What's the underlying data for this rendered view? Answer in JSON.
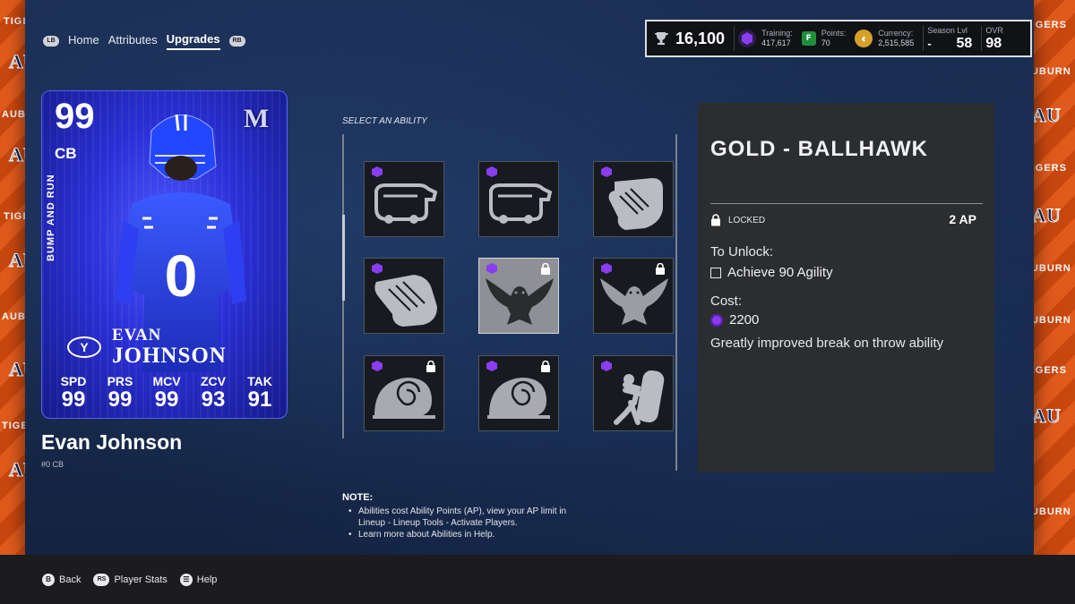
{
  "nav": {
    "lb": "LB",
    "rb": "RB",
    "tabs": [
      {
        "label": "Home"
      },
      {
        "label": "Attributes"
      },
      {
        "label": "Upgrades",
        "active": true
      }
    ]
  },
  "stats": {
    "trophy": "16,100",
    "training_label": "Training:",
    "training_value": "417,617",
    "points_label": "Points:",
    "points_value": "70",
    "currency_label": "Currency:",
    "currency_value": "2,515,585",
    "season_label": "Season Lvl",
    "season_value": "58",
    "season_prefix": "-",
    "ovr_label": "OVR",
    "ovr_value": "98"
  },
  "card": {
    "ovr": "99",
    "position": "CB",
    "archetype": "BUMP AND RUN",
    "badge": "M",
    "jersey": "0",
    "first_name": "EVAN",
    "last_name": "JOHNSON",
    "team_logo": "Y",
    "attributes": [
      {
        "key": "SPD",
        "value": "99"
      },
      {
        "key": "PRS",
        "value": "99"
      },
      {
        "key": "MCV",
        "value": "99"
      },
      {
        "key": "ZCV",
        "value": "93"
      },
      {
        "key": "TAK",
        "value": "91"
      }
    ]
  },
  "player": {
    "name": "Evan Johnson",
    "sub": "#0 CB"
  },
  "abilities": {
    "select_label": "SELECT AN ABILITY",
    "tiles": [
      {
        "icon": "tank-icon",
        "locked": false
      },
      {
        "icon": "tank-icon",
        "locked": false
      },
      {
        "icon": "hands-icon",
        "locked": false
      },
      {
        "icon": "hands-icon",
        "locked": false
      },
      {
        "icon": "hawk-icon",
        "locked": true,
        "selected": true
      },
      {
        "icon": "hawk-icon",
        "locked": true
      },
      {
        "icon": "snail-icon",
        "locked": true
      },
      {
        "icon": "snail-icon",
        "locked": true
      },
      {
        "icon": "blocking-sled-icon",
        "locked": false
      }
    ]
  },
  "detail": {
    "title": "GOLD - BALLHAWK",
    "status": "LOCKED",
    "ap": "2 AP",
    "unlock_heading": "To Unlock:",
    "requirement": "Achieve 90 Agility",
    "cost_heading": "Cost:",
    "cost": "2200",
    "description": "Greatly improved break on throw ability"
  },
  "note": {
    "heading": "NOTE:",
    "items": [
      "Abilities cost Ability Points (AP), view your AP limit in Lineup - Lineup Tools - Activate Players.",
      "Learn more about Abilities in Help."
    ]
  },
  "footer": {
    "back_key": "B",
    "back": "Back",
    "stats_key": "RS",
    "stats": "Player Stats",
    "help_key": "☰",
    "help": "Help"
  },
  "background": {
    "strip_word": "AUBURN",
    "strip_word_2": "TIGERS",
    "strip_mono": "AU"
  },
  "colors": {
    "card_blue": "#2a2fd6",
    "accent_purple": "#8a3cf0",
    "side_orange": "#e05a1b",
    "panel": "#2c2d2f"
  }
}
